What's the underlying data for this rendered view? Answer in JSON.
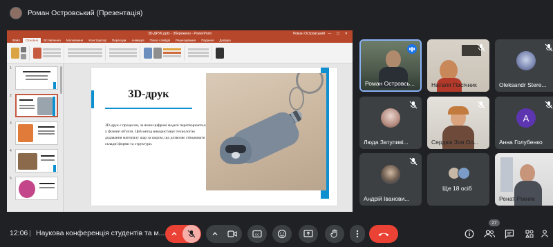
{
  "presenter_bar": {
    "title": "Роман Островський (Презентація)"
  },
  "powerpoint": {
    "window_title": "3D-ДРУК.pptx - Збережено - PowerPoint",
    "user": "Роман Островський",
    "tabs": [
      "Файл",
      "Основне",
      "Вставлення",
      "Малювання",
      "Конструктор",
      "Переходи",
      "Анімація",
      "Показ слайдів",
      "Рецензування",
      "Подання",
      "Довідка"
    ],
    "active_tab": "Основне",
    "thumbnail_numbers": [
      "1",
      "2",
      "3",
      "4",
      "5"
    ],
    "slide": {
      "title": "3D-друк",
      "body": "3D-друк є процесом, за яким цифрові моделі перетворюються у фізичні об'єкти. Цей метод використовує технологію додавання матеріалу шар за шаром, що дозволяє створювати складні форми та структури."
    }
  },
  "participants": [
    {
      "name": "Роман Островсь...",
      "muted": false,
      "speaking": true,
      "type": "video"
    },
    {
      "name": "Наталя Пасічник",
      "muted": true,
      "type": "video"
    },
    {
      "name": "Oleksandr Stere...",
      "muted": true,
      "type": "avatar"
    },
    {
      "name": "Люда Затуливі...",
      "muted": true,
      "type": "avatar"
    },
    {
      "name": "Сердюк Зоя Ол...",
      "muted": true,
      "type": "avatar"
    },
    {
      "name": "Анна Голубенко",
      "muted": true,
      "type": "letter",
      "letter": "А",
      "color": "#5e35b1"
    },
    {
      "name": "Андрій Іванови...",
      "muted": true,
      "type": "avatar"
    },
    {
      "name": "Ще 18 осіб",
      "muted": false,
      "type": "group"
    },
    {
      "name": "Ренат Ріжняк",
      "muted": false,
      "type": "video"
    }
  ],
  "bottom_bar": {
    "time": "12:06",
    "separator": "|",
    "meeting_name": "Наукова конференція студентів та м...",
    "participant_count": "27"
  },
  "colors": {
    "meet_bg": "#202124",
    "tile_bg": "#3c4043",
    "accent_red": "#ea4335",
    "ppt_red": "#b7472a",
    "slide_blue": "#0e8fd0"
  }
}
